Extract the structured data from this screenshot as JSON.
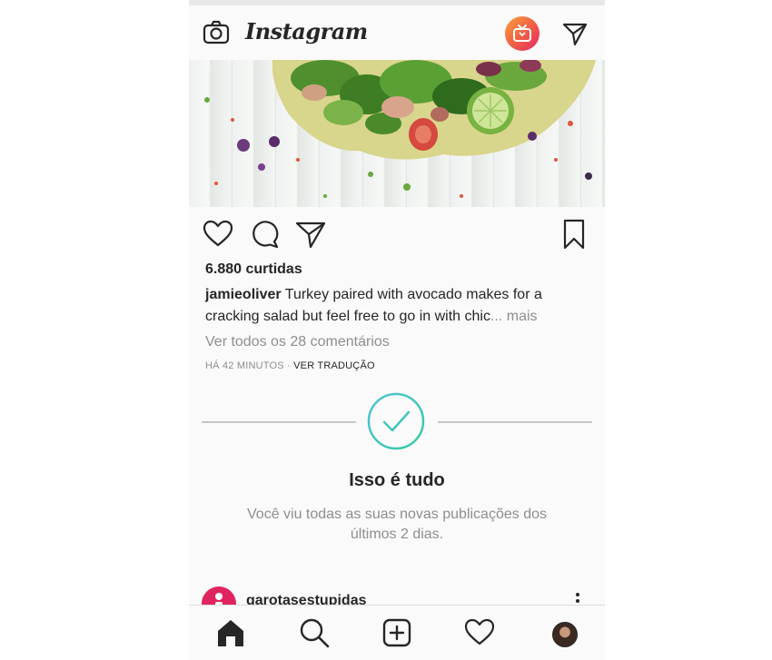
{
  "app": {
    "logo_text": "Instagram"
  },
  "post": {
    "likes": "6.880 curtidas",
    "username": "jamieoliver",
    "caption": "Turkey paired with avocado makes for a cracking salad but feel free to go in with chic",
    "more_label": "... mais",
    "comments_link": "Ver todos os 28 comentários",
    "time_ago": "HÁ 42 MINUTOS",
    "separator": " · ",
    "translate_label": "VER TRADUÇÃO"
  },
  "all_caught_up": {
    "title": "Isso é tudo",
    "subtitle": "Você viu todas as suas novas publicações dos últimos 2 dias."
  },
  "next_post": {
    "username": "garotasestupidas"
  },
  "icons": {
    "camera": "camera-icon",
    "igtv": "igtv-icon",
    "direct": "direct-message-icon",
    "like": "heart-icon",
    "comment": "comment-icon",
    "share": "share-icon",
    "save": "bookmark-icon",
    "check": "check-circle-icon",
    "home": "home-icon",
    "search": "search-icon",
    "new_post": "plus-square-icon",
    "activity": "heart-icon",
    "more": "more-vertical-icon"
  },
  "colors": {
    "text_primary": "#262626",
    "text_secondary": "#8e8e8e",
    "igtv_gradient_start": "#f9a23b",
    "igtv_gradient_end": "#e3296b",
    "check_gradient_start": "#4fc3d9",
    "check_gradient_end": "#37c9a2"
  }
}
